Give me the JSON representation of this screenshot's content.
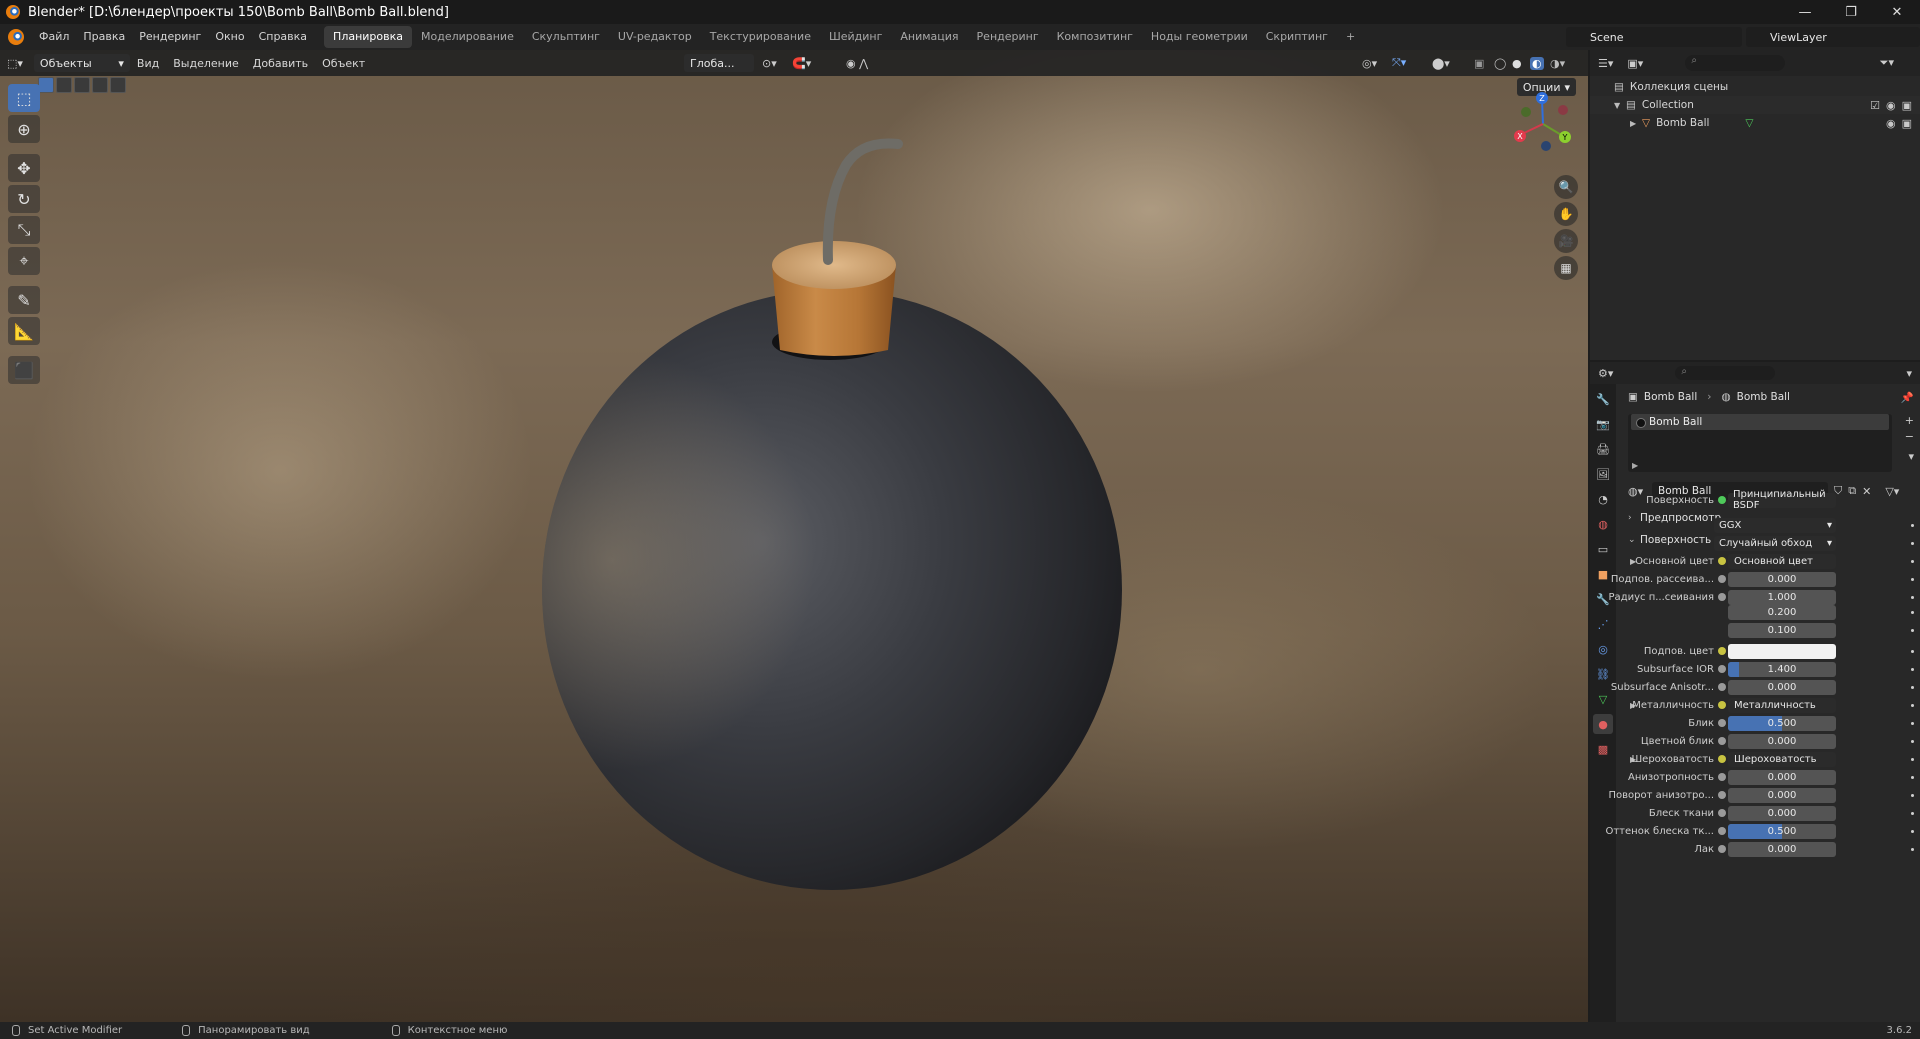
{
  "window": {
    "title": "Blender* [D:\\блендер\\проекты 150\\Bomb Ball\\Bomb Ball.blend]",
    "minimize": "—",
    "maximize": "❐",
    "close": "✕"
  },
  "menu": [
    "Файл",
    "Правка",
    "Рендеринг",
    "Окно",
    "Справка"
  ],
  "workspaces": {
    "tabs": [
      "Планировка",
      "Моделирование",
      "Скульптинг",
      "UV-редактор",
      "Текстурирование",
      "Шейдинг",
      "Анимация",
      "Рендеринг",
      "Композитинг",
      "Ноды геометрии",
      "Скриптинг"
    ],
    "active": "Планировка",
    "add": "+"
  },
  "scene": "Scene",
  "view_layer": "ViewLayer",
  "viewport_header": {
    "mode": "Объекты",
    "menus": [
      "Вид",
      "Выделение",
      "Добавить",
      "Объект"
    ],
    "orientation": "Глоба...",
    "options": "Опции"
  },
  "gizmo": {
    "x": "X",
    "y": "Y",
    "z": "Z"
  },
  "outliner": {
    "scene_collection": "Коллекция сцены",
    "collection": "Collection",
    "object": "Bomb Ball"
  },
  "properties": {
    "breadcrumb": {
      "object": "Bomb Ball",
      "material": "Bomb Ball"
    },
    "slot": "Bomb Ball",
    "material_name": "Bomb Ball",
    "panels": {
      "preview": "Предпросмотр",
      "surface": "Поверхность"
    },
    "surface_label": "Поверхность",
    "surface_shader": "Принципиальный BSDF",
    "distribution": "GGX",
    "subsurface_method": "Случайный обход",
    "rows": [
      {
        "label": "Основной цвет",
        "kind": "link",
        "value": "Основной цвет",
        "expand": true
      },
      {
        "label": "Подпов. рассеива...",
        "kind": "num",
        "value": "0.000"
      },
      {
        "label": "Радиус п...сеивания",
        "kind": "num",
        "value": "1.000"
      },
      {
        "label": "",
        "kind": "num",
        "value": "0.200"
      },
      {
        "label": "",
        "kind": "num",
        "value": "0.100"
      },
      {
        "label": "Подпов. цвет",
        "kind": "color",
        "value": ""
      },
      {
        "label": "Subsurface IOR",
        "kind": "num",
        "value": "1.400",
        "fill": 0.1
      },
      {
        "label": "Subsurface Anisotr...",
        "kind": "num",
        "value": "0.000"
      },
      {
        "label": "Металличность",
        "kind": "link",
        "value": "Металличность",
        "expand": true
      },
      {
        "label": "Блик",
        "kind": "num",
        "value": "0.500",
        "fill": 0.5
      },
      {
        "label": "Цветной блик",
        "kind": "num",
        "value": "0.000"
      },
      {
        "label": "Шероховатость",
        "kind": "link",
        "value": "Шероховатость",
        "expand": true
      },
      {
        "label": "Анизотропность",
        "kind": "num",
        "value": "0.000"
      },
      {
        "label": "Поворот анизотро...",
        "kind": "num",
        "value": "0.000"
      },
      {
        "label": "Блеск ткани",
        "kind": "num",
        "value": "0.000"
      },
      {
        "label": "Оттенок блеска тк...",
        "kind": "num",
        "value": "0.500",
        "fill": 0.5
      },
      {
        "label": "Лак",
        "kind": "num",
        "value": "0.000"
      }
    ]
  },
  "statusbar": {
    "left": "Set Active Modifier",
    "middle": "Панорамировать вид",
    "right": "Контекстное меню",
    "version": "3.6.2"
  },
  "colors": {
    "accent": "#4772b3",
    "link_dot": "#c8c341",
    "shader_dot": "#4ec95a",
    "value_dot": "#9a9a9a"
  }
}
